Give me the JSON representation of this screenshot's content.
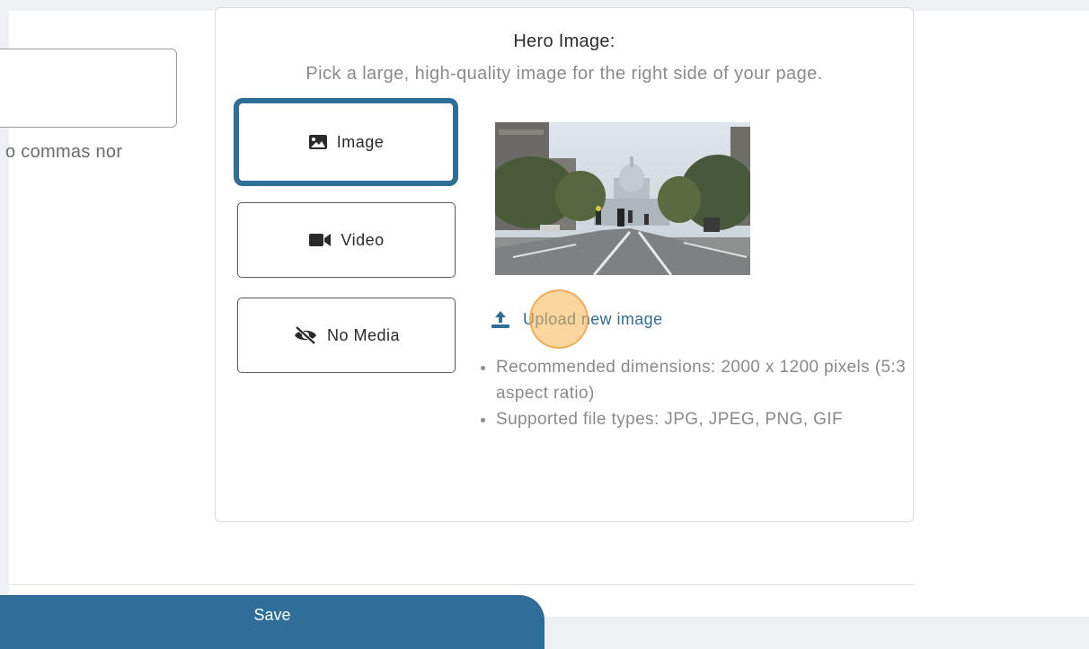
{
  "left_field": {
    "help_text": "o commas nor"
  },
  "hero": {
    "title": "Hero Image:",
    "subtitle": "Pick a large, high-quality image for the right side of your page.",
    "media_options": [
      {
        "label": "Image",
        "icon": "image-icon",
        "selected": true
      },
      {
        "label": "Video",
        "icon": "video-camera-icon",
        "selected": false
      },
      {
        "label": "No Media",
        "icon": "eye-slash-icon",
        "selected": false
      }
    ],
    "upload_label": "Upload new image",
    "hints": [
      "Recommended dimensions: 2000 x 1200 pixels (5:3 aspect ratio)",
      "Supported file types: JPG, JPEG, PNG, GIF"
    ]
  },
  "footer": {
    "save_label": "Save"
  },
  "colors": {
    "accent": "#2f6e98",
    "background": "#eef0f4",
    "cursor_highlight": "#f6b450"
  }
}
